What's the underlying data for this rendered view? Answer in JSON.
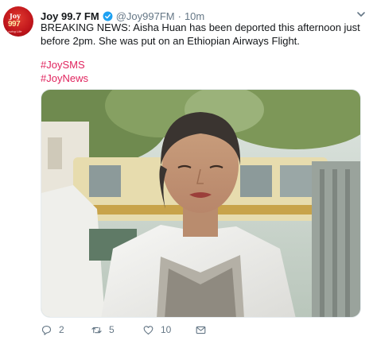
{
  "tweet": {
    "author_name": "Joy 99.7 FM",
    "handle": "@Joy997FM",
    "separator": "·",
    "time": "10m",
    "text": "BREAKING NEWS: Aisha Huan has been deported this afternoon just before 2pm. She was put on an Ethiopian Airways Flight.",
    "hashtags": [
      "#JoySMS",
      "#JoyNews"
    ],
    "avatar": {
      "icon": "joy-fm-logo-icon",
      "logo_text": "Joy",
      "logo_number": "997",
      "logo_tagline": "Loving Life"
    },
    "media_icon": "photo-woman-in-white-jacket"
  },
  "actions": {
    "reply_count": "2",
    "retweet_count": "5",
    "like_count": "10"
  },
  "colors": {
    "hashtag": "#e0245e",
    "secondary_text": "#657786",
    "verified": "#1da1f2"
  }
}
